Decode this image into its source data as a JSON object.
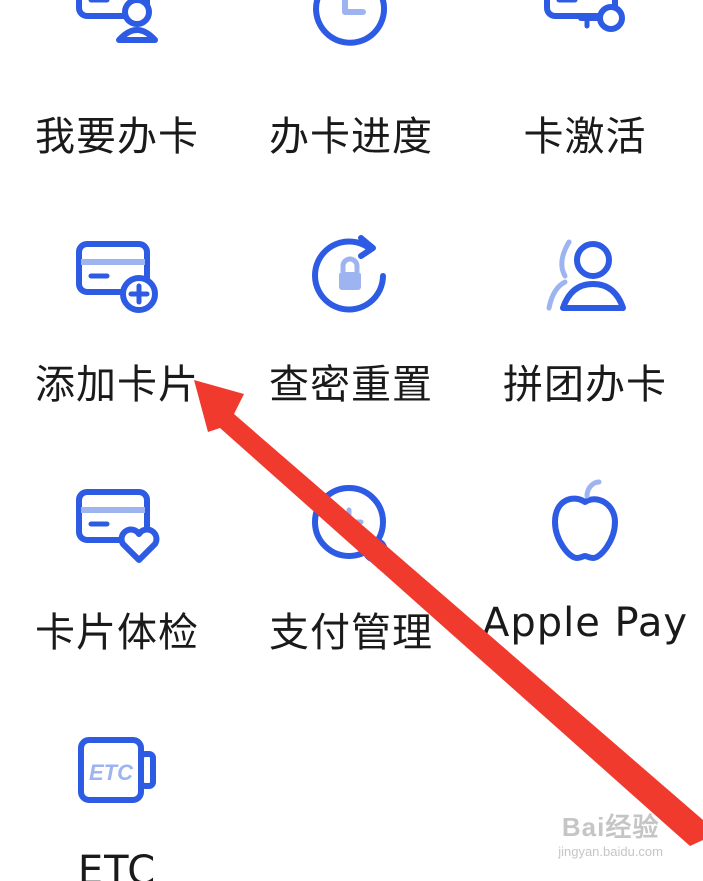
{
  "accent_color": "#2d5be3",
  "accent_light_color": "#9db4f0",
  "arrow_color": "#f03a2e",
  "menu_items": [
    {
      "label": "我要办卡",
      "icon": "card-user-icon"
    },
    {
      "label": "办卡进度",
      "icon": "clock-progress-icon"
    },
    {
      "label": "卡激活",
      "icon": "card-key-icon"
    },
    {
      "label": "添加卡片",
      "icon": "card-plus-icon"
    },
    {
      "label": "查密重置",
      "icon": "lock-refresh-icon"
    },
    {
      "label": "拼团办卡",
      "icon": "group-users-icon"
    },
    {
      "label": "卡片体检",
      "icon": "card-heart-icon"
    },
    {
      "label": "支付管理",
      "icon": "payment-settings-icon"
    },
    {
      "label": "Apple Pay",
      "icon": "apple-icon"
    },
    {
      "label": "ETC",
      "icon": "etc-card-icon"
    }
  ],
  "etc_icon_text": "ETC",
  "watermark": {
    "main": "Bai经验",
    "sub": "jingyan.baidu.com"
  }
}
